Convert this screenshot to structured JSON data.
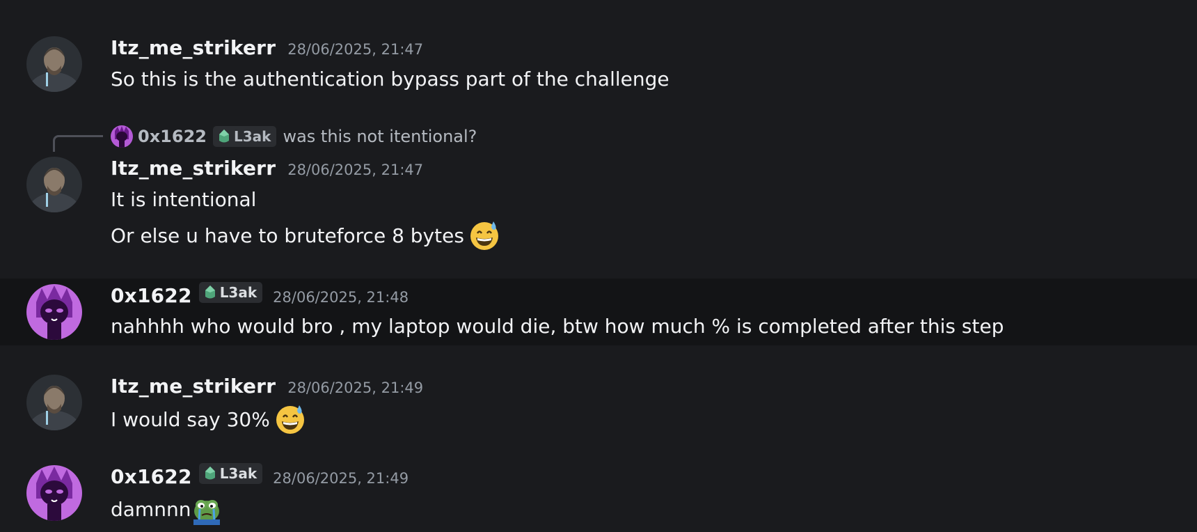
{
  "messages": [
    {
      "author": "Itz_me_strikerr",
      "timestamp": "28/06/2025, 21:47",
      "lines": [
        "So this is the authentication bypass part of the challenge"
      ]
    },
    {
      "reply": {
        "author": "0x1622",
        "tag": "L3ak",
        "text": "was this not itentional?"
      },
      "author": "Itz_me_strikerr",
      "timestamp": "28/06/2025, 21:47",
      "lines": [
        "It is intentional",
        "Or else u have to bruteforce 8 bytes"
      ],
      "emoji": "grinning-sweat-emoji"
    },
    {
      "author": "0x1622",
      "tag": "L3ak",
      "timestamp": "28/06/2025, 21:48",
      "lines": [
        "nahhhh who would bro , my laptop would die, btw how much % is completed after this step"
      ],
      "highlighted": true
    },
    {
      "author": "Itz_me_strikerr",
      "timestamp": "28/06/2025, 21:49",
      "lines": [
        "I would say 30%"
      ],
      "emoji": "grinning-sweat-emoji"
    },
    {
      "author": "0x1622",
      "tag": "L3ak",
      "timestamp": "28/06/2025, 21:49",
      "lines": [
        "damnnn"
      ],
      "emoji": "crying-pepe-emoji"
    }
  ],
  "colors": {
    "background": "#1a1b1e",
    "highlight_row": "#131416",
    "username": "#f2f3f5",
    "timestamp": "#949ba4",
    "tag_gem": "#4fa57a"
  }
}
